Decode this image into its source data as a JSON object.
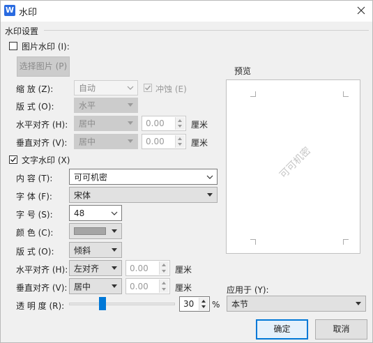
{
  "window": {
    "title": "水印",
    "app_icon_letter": "W"
  },
  "group_title": "水印设置",
  "picture": {
    "checkbox_label": "图片水印 (I):",
    "checked": false,
    "select_button": "选择图片 (P)",
    "scale_label": "缩  放 (Z):",
    "scale_value": "自动",
    "washout_label": "冲蚀 (E)",
    "layout_label": "版  式 (O):",
    "layout_value": "水平",
    "halign_label": "水平对齐 (H):",
    "halign_value": "居中",
    "halign_offset": "0.00",
    "valign_label": "垂直对齐 (V):",
    "valign_value": "居中",
    "valign_offset": "0.00",
    "unit": "厘米"
  },
  "text": {
    "checkbox_label": "文字水印 (X)",
    "checked": true,
    "content_label": "内  容 (T):",
    "content_value": "可可机密",
    "font_label": "字  体 (F):",
    "font_value": "宋体",
    "size_label": "字  号 (S):",
    "size_value": "48",
    "color_label": "颜  色 (C):",
    "color_value": "#a5a5a5",
    "layout_label": "版  式 (O):",
    "layout_value": "倾斜",
    "halign_label": "水平对齐 (H):",
    "halign_value": "左对齐",
    "halign_offset": "0.00",
    "valign_label": "垂直对齐 (V):",
    "valign_value": "居中",
    "valign_offset": "0.00",
    "unit": "厘米",
    "transparency_label": "透 明 度 (R):",
    "transparency_value": "30",
    "transparency_percent": 30,
    "percent_sign": "%"
  },
  "preview": {
    "label": "预览",
    "watermark_text": "可可机密"
  },
  "apply": {
    "label": "应用于 (Y):",
    "value": "本节"
  },
  "buttons": {
    "ok": "确定",
    "cancel": "取消"
  },
  "colors": {
    "accent": "#0078d7",
    "disabled_fill": "#cccccc"
  }
}
